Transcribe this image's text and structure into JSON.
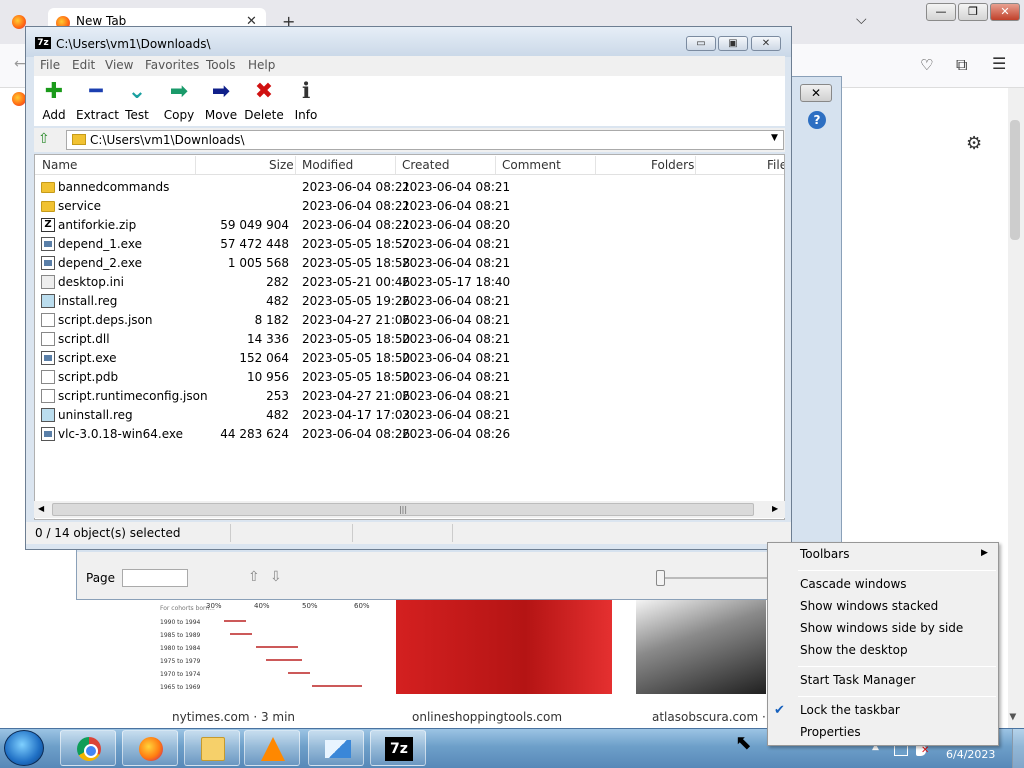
{
  "firefox": {
    "tab_title": "New Tab",
    "tab_close": "✕",
    "new_tab": "+",
    "list_tabs": "⌵",
    "window_controls": [
      "—",
      "❐",
      "✕"
    ],
    "back": "←",
    "pocket": "♡",
    "extensions": "⧉",
    "menu": "☰",
    "settings_gear": "⚙",
    "news_cards": [
      {
        "source": "nytimes.com · 3 min"
      },
      {
        "source": "onlineshoppingtools.com"
      },
      {
        "source": "atlasobscura.com · 4"
      }
    ],
    "mini_chart_axis": [
      "30%",
      "40%",
      "50%",
      "60%"
    ],
    "mini_chart_rows": [
      "1990 to 1994",
      "1985 to 1989",
      "1980 to 1984",
      "1975 to 1979",
      "1970 to 1974",
      "1965 to 1969"
    ],
    "mini_chart_heading": "For cohorts born..."
  },
  "dialog2": {
    "close": "✕",
    "help": "?",
    "page_label": "Page",
    "page_up": "⇧",
    "page_down": "⇩"
  },
  "sevenzip": {
    "app_icon": "7z",
    "title": "C:\\Users\\vm1\\Downloads\\",
    "window_controls": [
      "▭",
      "▣",
      "✕"
    ],
    "menu": [
      "File",
      "Edit",
      "View",
      "Favorites",
      "Tools",
      "Help"
    ],
    "toolbar": [
      {
        "label": "Add",
        "glyph": "✚",
        "color": "#1a9a1a"
      },
      {
        "label": "Extract",
        "glyph": "━",
        "color": "#1b3fb0"
      },
      {
        "label": "Test",
        "glyph": "⌄",
        "color": "#1aa0a0"
      },
      {
        "label": "Copy",
        "glyph": "➡",
        "color": "#1a9a6a"
      },
      {
        "label": "Move",
        "glyph": "➡",
        "color": "#10208a"
      },
      {
        "label": "Delete",
        "glyph": "✖",
        "color": "#d01010"
      },
      {
        "label": "Info",
        "glyph": "ℹ",
        "color": "#333333"
      }
    ],
    "address": "C:\\Users\\vm1\\Downloads\\",
    "columns": [
      "Name",
      "Size",
      "Modified",
      "Created",
      "Comment",
      "Folders",
      "File"
    ],
    "files": [
      {
        "name": "bannedcommands",
        "size": "",
        "modified": "2023-06-04 08:21",
        "created": "2023-06-04 08:21",
        "icon": "folder"
      },
      {
        "name": "service",
        "size": "",
        "modified": "2023-06-04 08:21",
        "created": "2023-06-04 08:21",
        "icon": "folder"
      },
      {
        "name": "antiforkie.zip",
        "size": "59 049 904",
        "modified": "2023-06-04 08:21",
        "created": "2023-06-04 08:20",
        "icon": "zip"
      },
      {
        "name": "depend_1.exe",
        "size": "57 472 448",
        "modified": "2023-05-05 18:57",
        "created": "2023-06-04 08:21",
        "icon": "exe"
      },
      {
        "name": "depend_2.exe",
        "size": "1 005 568",
        "modified": "2023-05-05 18:58",
        "created": "2023-06-04 08:21",
        "icon": "exe"
      },
      {
        "name": "desktop.ini",
        "size": "282",
        "modified": "2023-05-21 00:46",
        "created": "2023-05-17 18:40",
        "icon": "ini"
      },
      {
        "name": "install.reg",
        "size": "482",
        "modified": "2023-05-05 19:26",
        "created": "2023-06-04 08:21",
        "icon": "reg"
      },
      {
        "name": "script.deps.json",
        "size": "8 182",
        "modified": "2023-04-27 21:06",
        "created": "2023-06-04 08:21",
        "icon": "doc"
      },
      {
        "name": "script.dll",
        "size": "14 336",
        "modified": "2023-05-05 18:50",
        "created": "2023-06-04 08:21",
        "icon": "dll"
      },
      {
        "name": "script.exe",
        "size": "152 064",
        "modified": "2023-05-05 18:50",
        "created": "2023-06-04 08:21",
        "icon": "exe"
      },
      {
        "name": "script.pdb",
        "size": "10 956",
        "modified": "2023-05-05 18:50",
        "created": "2023-06-04 08:21",
        "icon": "doc"
      },
      {
        "name": "script.runtimeconfig.json",
        "size": "253",
        "modified": "2023-04-27 21:06",
        "created": "2023-06-04 08:21",
        "icon": "doc"
      },
      {
        "name": "uninstall.reg",
        "size": "482",
        "modified": "2023-04-17 17:03",
        "created": "2023-06-04 08:21",
        "icon": "reg"
      },
      {
        "name": "vlc-3.0.18-win64.exe",
        "size": "44 283 624",
        "modified": "2023-06-04 08:26",
        "created": "2023-06-04 08:26",
        "icon": "exe"
      }
    ],
    "status": "0 / 14 object(s) selected",
    "scroll_grip": "|||"
  },
  "context_menu": {
    "items": [
      {
        "label": "Toolbars",
        "submenu": true
      },
      {
        "label": "Cascade windows"
      },
      {
        "label": "Show windows stacked"
      },
      {
        "label": "Show windows side by side"
      },
      {
        "label": "Show the desktop"
      },
      {
        "label": "Start Task Manager"
      },
      {
        "label": "Lock the taskbar",
        "checked": true
      },
      {
        "label": "Properties"
      }
    ],
    "submenu_arrow": "▶",
    "check_mark": "✔"
  },
  "taskbar": {
    "clock_date": "6/4/2023",
    "tray_up": "▲",
    "sound_x": "✕",
    "sevenzip_label": "7z"
  },
  "cursor": "⬉"
}
